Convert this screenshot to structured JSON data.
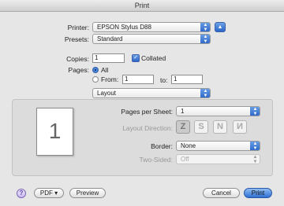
{
  "window": {
    "title": "Print"
  },
  "printer": {
    "label": "Printer:",
    "value": "EPSON Stylus D88"
  },
  "presets": {
    "label": "Presets:",
    "value": "Standard"
  },
  "copies": {
    "label": "Copies:",
    "value": "1",
    "collated_label": "Collated",
    "collated": true
  },
  "pages": {
    "label": "Pages:",
    "all_label": "All",
    "from_label": "From:",
    "from_value": "1",
    "to_label": "to:",
    "to_value": "1",
    "selected": "all"
  },
  "panel": {
    "value": "Layout"
  },
  "layout": {
    "pages_per_sheet_label": "Pages per Sheet:",
    "pages_per_sheet": "1",
    "direction_label": "Layout Direction:",
    "directions": [
      "Z",
      "S",
      "N",
      "N"
    ],
    "border_label": "Border:",
    "border": "None",
    "two_sided_label": "Two-Sided:",
    "two_sided": "Off",
    "preview_page": "1"
  },
  "buttons": {
    "help": "?",
    "pdf": "PDF ▾",
    "preview": "Preview",
    "cancel": "Cancel",
    "print": "Print"
  },
  "colors": {
    "accent": "#2b66c9",
    "window_bg": "#e6e6e6"
  }
}
